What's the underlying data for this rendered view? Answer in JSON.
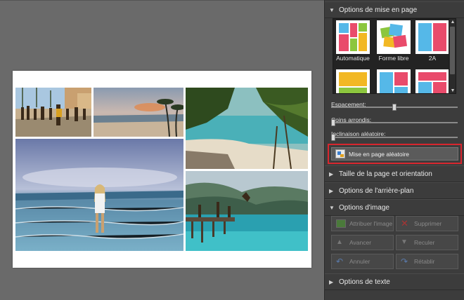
{
  "panel": {
    "sections": {
      "layout_options": "Options de mise en page",
      "page_size": "Taille de la page et orientation",
      "background": "Options de l'arrière-plan",
      "image_options": "Options d'image",
      "text_options": "Options de texte"
    },
    "layouts": [
      {
        "label": "Automatique",
        "selected": true
      },
      {
        "label": "Forme libre",
        "selected": false
      },
      {
        "label": "2A",
        "selected": false
      },
      {
        "label": "",
        "selected": false
      },
      {
        "label": "",
        "selected": false
      },
      {
        "label": "",
        "selected": false
      }
    ],
    "sliders": {
      "spacing": {
        "label": "Espacement:",
        "value": 0.5
      },
      "corners": {
        "label": "Coins arrondis:",
        "value": 0.0
      },
      "tilt": {
        "label": "Inclinaison aléatoire:",
        "value": 0.0
      }
    },
    "random_layout_button": "Mise en page aléatoire",
    "image_buttons": {
      "assign": "Attribuer l'image",
      "delete": "Supprimer",
      "forward": "Avancer",
      "backward": "Reculer",
      "undo": "Annuler",
      "redo": "Rétablir"
    }
  },
  "colors": {
    "panel_bg": "#3c3c3c",
    "canvas_bg": "#6a6a6a",
    "highlight": "#d8262e"
  }
}
